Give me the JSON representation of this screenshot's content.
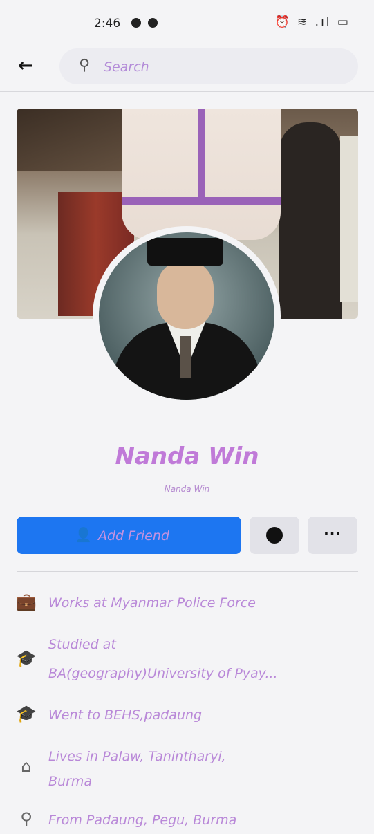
{
  "status_bar": {
    "time": "2:46",
    "right_icons": "⏰ ≋ .ıl ▭"
  },
  "topbar": {
    "back_icon": "←",
    "search_icon": "⚲",
    "search_placeholder": "Search"
  },
  "profile": {
    "name": "Nanda Win",
    "alt_name": "Nanda Win"
  },
  "actions": {
    "add_friend_icon": "👤",
    "add_friend_label": "Add Friend",
    "more_label": "···"
  },
  "info": [
    {
      "icon": "briefcase-icon",
      "glyph": "💼",
      "text_lines": [
        "Works at Myanmar Police Force"
      ]
    },
    {
      "icon": "graduation-cap-icon",
      "glyph": "🎓",
      "text_lines": [
        "Studied at",
        "BA(geography)University of Pyay..."
      ]
    },
    {
      "icon": "graduation-cap-icon",
      "glyph": "🎓",
      "text_lines": [
        "Went to BEHS,padaung"
      ]
    },
    {
      "icon": "home-icon",
      "glyph": "⌂",
      "text_lines": [
        "Lives in Palaw, Tanintharyi,",
        "Burma"
      ]
    },
    {
      "icon": "location-pin-icon",
      "glyph": "⚲",
      "text_lines": [
        "From Padaung, Pegu, Burma"
      ]
    }
  ],
  "colors": {
    "accent": "#1d76f1",
    "name_text": "#c07ad8",
    "info_text": "#b988d8"
  }
}
